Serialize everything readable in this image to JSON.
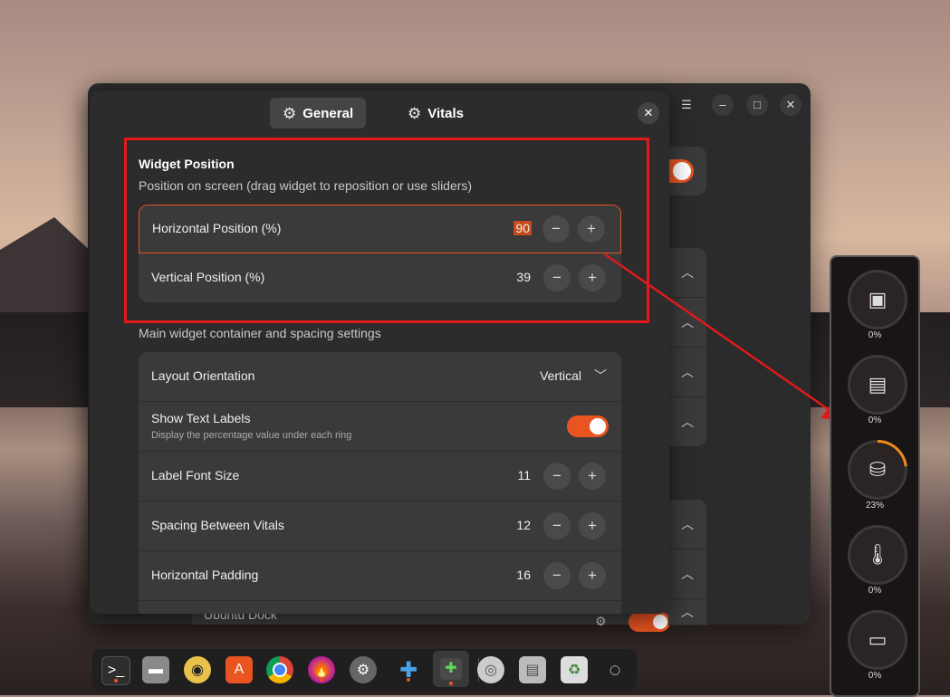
{
  "dialog": {
    "tabs": [
      {
        "label": "General",
        "active": true
      },
      {
        "label": "Vitals",
        "active": false
      }
    ],
    "widget_position": {
      "title": "Widget Position",
      "subtitle": "Position on screen (drag widget to reposition or use sliders)",
      "horizontal": {
        "label": "Horizontal Position (%)",
        "value": "90"
      },
      "vertical": {
        "label": "Vertical Position (%)",
        "value": "39"
      }
    },
    "container_subtitle": "Main widget container and spacing settings",
    "layout_orientation": {
      "label": "Layout Orientation",
      "value": "Vertical"
    },
    "show_text_labels": {
      "label": "Show Text Labels",
      "description": "Display the percentage value under each ring",
      "enabled": true
    },
    "label_font_size": {
      "label": "Label Font Size",
      "value": "11"
    },
    "spacing": {
      "label": "Spacing Between Vitals",
      "value": "12"
    },
    "horizontal_padding": {
      "label": "Horizontal Padding",
      "value": "16"
    }
  },
  "back_window": {
    "bottom_row_label": "Ubuntu Dock"
  },
  "vitals_widget": {
    "items": [
      {
        "icon": "cpu-icon",
        "value": "0%"
      },
      {
        "icon": "memory-icon",
        "value": "0%"
      },
      {
        "icon": "storage-icon",
        "value": "23%",
        "progress": 0.23
      },
      {
        "icon": "temperature-icon",
        "value": "0%"
      },
      {
        "icon": "gpu-icon",
        "value": "0%"
      }
    ],
    "accent_color": "#f08a1c"
  },
  "dock": {
    "apps": [
      "terminal-icon",
      "files-icon",
      "rhythmbox-icon",
      "app-center-icon",
      "chrome-icon",
      "firefox-icon",
      "settings-icon",
      "extensions-icon",
      "extension-manager-icon",
      "disc-icon",
      "save-icon",
      "trash-icon",
      "ubuntu-icon"
    ]
  },
  "colors": {
    "accent": "#e95420",
    "highlight_box": "#e01a1a"
  }
}
